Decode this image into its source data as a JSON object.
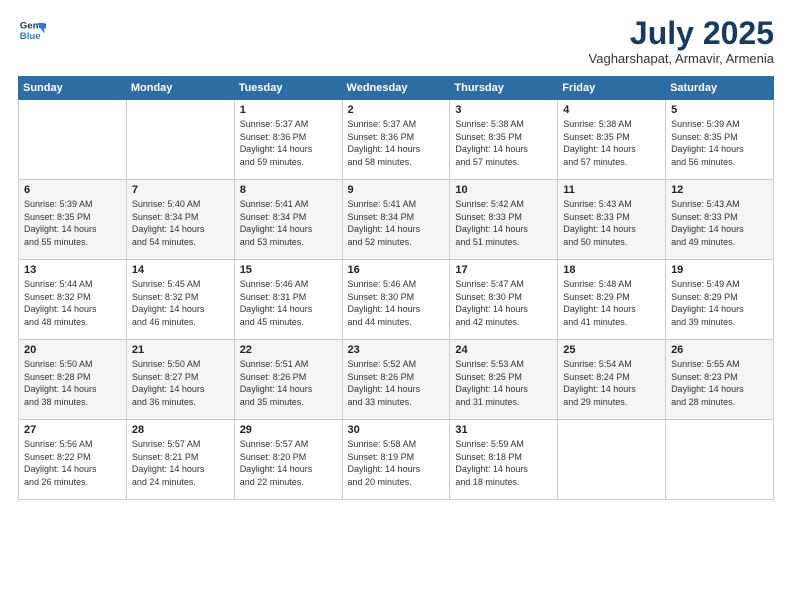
{
  "logo": {
    "line1": "General",
    "line2": "Blue"
  },
  "title": "July 2025",
  "subtitle": "Vagharshapat, Armavir, Armenia",
  "days_header": [
    "Sunday",
    "Monday",
    "Tuesday",
    "Wednesday",
    "Thursday",
    "Friday",
    "Saturday"
  ],
  "weeks": [
    [
      {
        "day": "",
        "info": ""
      },
      {
        "day": "",
        "info": ""
      },
      {
        "day": "1",
        "info": "Sunrise: 5:37 AM\nSunset: 8:36 PM\nDaylight: 14 hours\nand 59 minutes."
      },
      {
        "day": "2",
        "info": "Sunrise: 5:37 AM\nSunset: 8:36 PM\nDaylight: 14 hours\nand 58 minutes."
      },
      {
        "day": "3",
        "info": "Sunrise: 5:38 AM\nSunset: 8:35 PM\nDaylight: 14 hours\nand 57 minutes."
      },
      {
        "day": "4",
        "info": "Sunrise: 5:38 AM\nSunset: 8:35 PM\nDaylight: 14 hours\nand 57 minutes."
      },
      {
        "day": "5",
        "info": "Sunrise: 5:39 AM\nSunset: 8:35 PM\nDaylight: 14 hours\nand 56 minutes."
      }
    ],
    [
      {
        "day": "6",
        "info": "Sunrise: 5:39 AM\nSunset: 8:35 PM\nDaylight: 14 hours\nand 55 minutes."
      },
      {
        "day": "7",
        "info": "Sunrise: 5:40 AM\nSunset: 8:34 PM\nDaylight: 14 hours\nand 54 minutes."
      },
      {
        "day": "8",
        "info": "Sunrise: 5:41 AM\nSunset: 8:34 PM\nDaylight: 14 hours\nand 53 minutes."
      },
      {
        "day": "9",
        "info": "Sunrise: 5:41 AM\nSunset: 8:34 PM\nDaylight: 14 hours\nand 52 minutes."
      },
      {
        "day": "10",
        "info": "Sunrise: 5:42 AM\nSunset: 8:33 PM\nDaylight: 14 hours\nand 51 minutes."
      },
      {
        "day": "11",
        "info": "Sunrise: 5:43 AM\nSunset: 8:33 PM\nDaylight: 14 hours\nand 50 minutes."
      },
      {
        "day": "12",
        "info": "Sunrise: 5:43 AM\nSunset: 8:33 PM\nDaylight: 14 hours\nand 49 minutes."
      }
    ],
    [
      {
        "day": "13",
        "info": "Sunrise: 5:44 AM\nSunset: 8:32 PM\nDaylight: 14 hours\nand 48 minutes."
      },
      {
        "day": "14",
        "info": "Sunrise: 5:45 AM\nSunset: 8:32 PM\nDaylight: 14 hours\nand 46 minutes."
      },
      {
        "day": "15",
        "info": "Sunrise: 5:46 AM\nSunset: 8:31 PM\nDaylight: 14 hours\nand 45 minutes."
      },
      {
        "day": "16",
        "info": "Sunrise: 5:46 AM\nSunset: 8:30 PM\nDaylight: 14 hours\nand 44 minutes."
      },
      {
        "day": "17",
        "info": "Sunrise: 5:47 AM\nSunset: 8:30 PM\nDaylight: 14 hours\nand 42 minutes."
      },
      {
        "day": "18",
        "info": "Sunrise: 5:48 AM\nSunset: 8:29 PM\nDaylight: 14 hours\nand 41 minutes."
      },
      {
        "day": "19",
        "info": "Sunrise: 5:49 AM\nSunset: 8:29 PM\nDaylight: 14 hours\nand 39 minutes."
      }
    ],
    [
      {
        "day": "20",
        "info": "Sunrise: 5:50 AM\nSunset: 8:28 PM\nDaylight: 14 hours\nand 38 minutes."
      },
      {
        "day": "21",
        "info": "Sunrise: 5:50 AM\nSunset: 8:27 PM\nDaylight: 14 hours\nand 36 minutes."
      },
      {
        "day": "22",
        "info": "Sunrise: 5:51 AM\nSunset: 8:26 PM\nDaylight: 14 hours\nand 35 minutes."
      },
      {
        "day": "23",
        "info": "Sunrise: 5:52 AM\nSunset: 8:26 PM\nDaylight: 14 hours\nand 33 minutes."
      },
      {
        "day": "24",
        "info": "Sunrise: 5:53 AM\nSunset: 8:25 PM\nDaylight: 14 hours\nand 31 minutes."
      },
      {
        "day": "25",
        "info": "Sunrise: 5:54 AM\nSunset: 8:24 PM\nDaylight: 14 hours\nand 29 minutes."
      },
      {
        "day": "26",
        "info": "Sunrise: 5:55 AM\nSunset: 8:23 PM\nDaylight: 14 hours\nand 28 minutes."
      }
    ],
    [
      {
        "day": "27",
        "info": "Sunrise: 5:56 AM\nSunset: 8:22 PM\nDaylight: 14 hours\nand 26 minutes."
      },
      {
        "day": "28",
        "info": "Sunrise: 5:57 AM\nSunset: 8:21 PM\nDaylight: 14 hours\nand 24 minutes."
      },
      {
        "day": "29",
        "info": "Sunrise: 5:57 AM\nSunset: 8:20 PM\nDaylight: 14 hours\nand 22 minutes."
      },
      {
        "day": "30",
        "info": "Sunrise: 5:58 AM\nSunset: 8:19 PM\nDaylight: 14 hours\nand 20 minutes."
      },
      {
        "day": "31",
        "info": "Sunrise: 5:59 AM\nSunset: 8:18 PM\nDaylight: 14 hours\nand 18 minutes."
      },
      {
        "day": "",
        "info": ""
      },
      {
        "day": "",
        "info": ""
      }
    ]
  ]
}
